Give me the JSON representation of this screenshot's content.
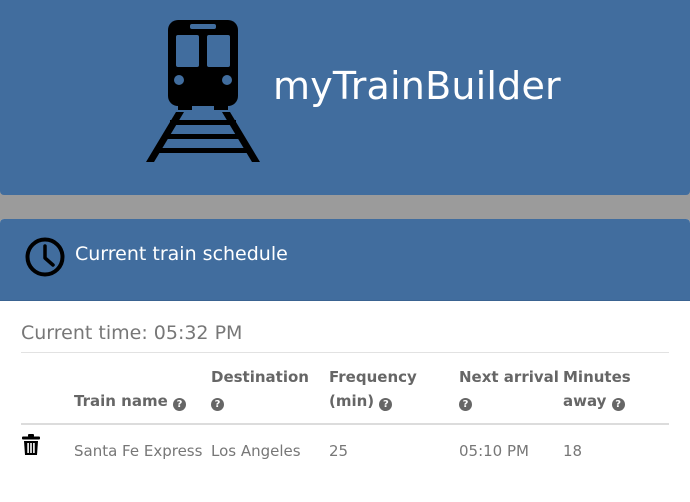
{
  "header": {
    "title": "myTrainBuilder",
    "logo_icon": "train-icon",
    "background": "#416d9e"
  },
  "schedule": {
    "title": "Current train schedule",
    "icon": "clock-icon",
    "current_time": "Current time: 05:32 PM",
    "columns": {
      "name": "Train name",
      "destination": "Destination",
      "frequency": "Frequency (min)",
      "next_arrival": "Next arrival",
      "minutes_away": "Minutes away"
    },
    "rows": [
      {
        "name": "Santa Fe Express",
        "destination": "Los Angeles",
        "frequency": "25",
        "next_arrival": "05:10 PM",
        "minutes_away": "18",
        "delete_icon": "trash-icon"
      }
    ]
  }
}
